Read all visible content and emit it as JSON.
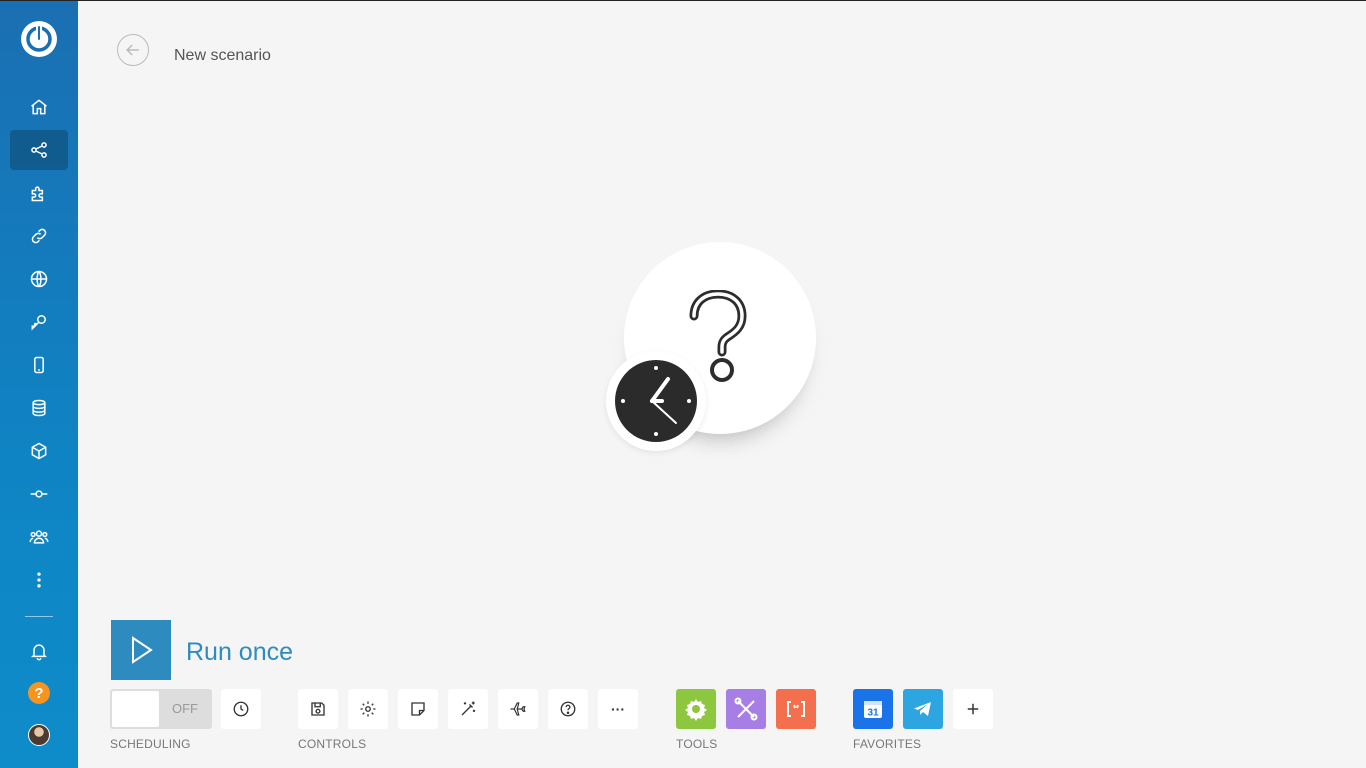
{
  "header": {
    "title": "New scenario"
  },
  "sidebar": {
    "items": [
      {
        "name": "home",
        "icon": "home-icon"
      },
      {
        "name": "scenarios",
        "icon": "share-icon",
        "active": true
      },
      {
        "name": "templates",
        "icon": "puzzle-icon"
      },
      {
        "name": "connections",
        "icon": "link-icon"
      },
      {
        "name": "webhooks",
        "icon": "globe-icon"
      },
      {
        "name": "keys",
        "icon": "key-icon"
      },
      {
        "name": "devices",
        "icon": "mobile-icon"
      },
      {
        "name": "data-stores",
        "icon": "database-icon"
      },
      {
        "name": "data-structures",
        "icon": "cube-icon"
      },
      {
        "name": "custom-apps",
        "icon": "commit-icon"
      },
      {
        "name": "team",
        "icon": "users-icon"
      },
      {
        "name": "more",
        "icon": "more-vertical-icon"
      }
    ],
    "bottom": {
      "help_label": "?"
    }
  },
  "toolbar": {
    "run_label": "Run once",
    "toggle_label": "OFF",
    "sections": {
      "scheduling": "SCHEDULING",
      "controls": "CONTROLS",
      "tools": "TOOLS",
      "favorites": "FAVORITES"
    },
    "more_label": "···",
    "colors": {
      "tools_gear": "#8dc63f",
      "tools_flow": "#a77ee6",
      "tools_text": "#f36f4d",
      "calendar": "#1a73e8",
      "telegram": "#2ca5e0"
    }
  }
}
